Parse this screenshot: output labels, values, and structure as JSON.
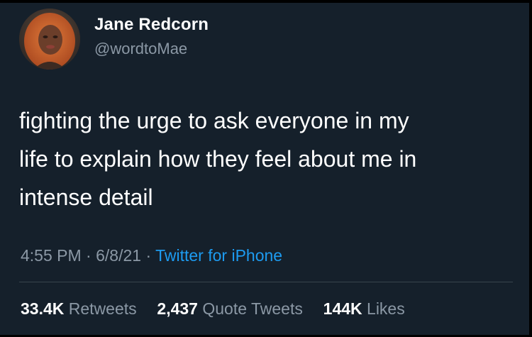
{
  "author": {
    "display_name": "Jane Redcorn",
    "handle": "@wordtoMae"
  },
  "tweet": {
    "lines": [
      "fighting the urge to ask everyone in my",
      "life to explain how they feel about me in",
      "intense detail"
    ]
  },
  "meta": {
    "time": "4:55 PM",
    "separator": "·",
    "date": "6/8/21",
    "source": "Twitter for iPhone"
  },
  "stats": {
    "retweets_count": "33.4K",
    "retweets_label": "Retweets",
    "quotes_count": "2,437",
    "quotes_label": "Quote Tweets",
    "likes_count": "144K",
    "likes_label": "Likes"
  },
  "colors": {
    "background": "#15202b",
    "text": "#ffffff",
    "secondary_text": "#8b98a5",
    "link": "#1d9bf0",
    "divider": "#38444d"
  }
}
